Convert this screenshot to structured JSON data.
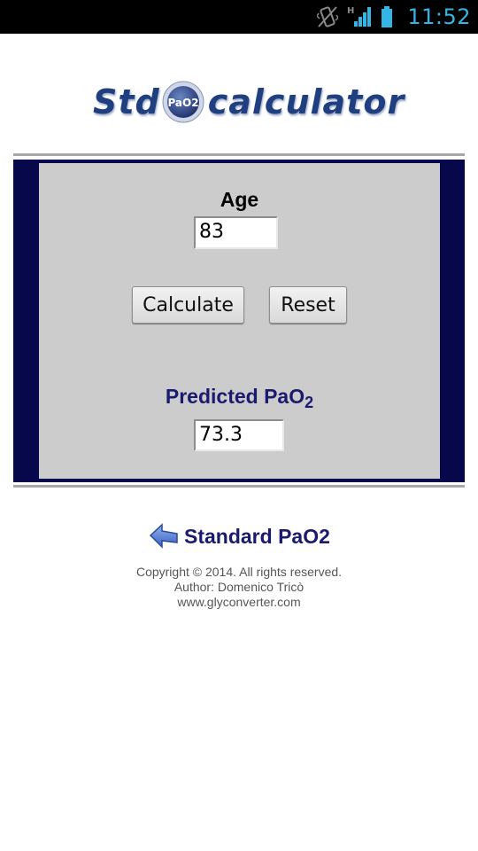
{
  "status_bar": {
    "time": "11:52",
    "icons": [
      "vibrate-icon",
      "network-h-icon",
      "signal-icon",
      "battery-icon"
    ],
    "clock_color": "#33b5e5"
  },
  "logo": {
    "left_word": "Std",
    "right_word": "calculator",
    "badge_text": "PaO2",
    "color": "#1f3f80"
  },
  "form": {
    "age_label": "Age",
    "age_value": "83",
    "calculate_label": "Calculate",
    "reset_label": "Reset",
    "result_label_main": "Predicted PaO",
    "result_label_sub": "2",
    "result_value": "73.3"
  },
  "nav": {
    "back_label": "Standard PaO2",
    "back_icon": "back-arrow-icon"
  },
  "footer": {
    "copyright": "Copyright © 2014. All rights reserved.",
    "author": "Author: Domenico Tricò",
    "website": "www.glyconverter.com"
  },
  "colors": {
    "frame": "#07074b",
    "panel": "#cccccc",
    "label_blue": "#1a1a6e"
  }
}
